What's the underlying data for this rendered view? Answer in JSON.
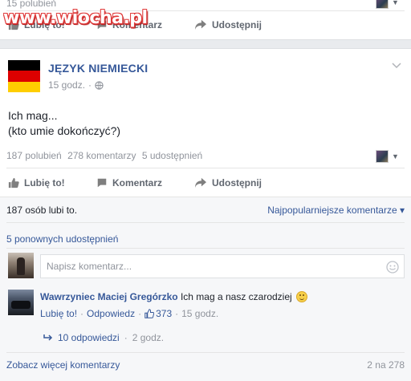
{
  "watermark": "www.wiocha.pl",
  "top_post": {
    "likes_text": "15 polubień",
    "actions": {
      "like": "Lubię to!",
      "comment": "Komentarz",
      "share": "Udostępnij"
    }
  },
  "post": {
    "author": "JĘZYK NIEMIECKI",
    "time": "15 godz.",
    "dot": "·",
    "text_line1": "Ich mag...",
    "text_line2": "(kto umie dokończyć?)",
    "stats": {
      "likes": "187 polubień",
      "comments": "278 komentarzy",
      "shares": "5 udostępnień"
    },
    "actions": {
      "like": "Lubię to!",
      "comment": "Komentarz",
      "share": "Udostępnij"
    },
    "likes_line": "187 osób lubi to.",
    "sort_label": "Najpopularniejsze komentarze",
    "sort_caret": "▾",
    "reshares": "5 ponownych udostępnień",
    "comment_placeholder": "Napisz komentarz...",
    "comment": {
      "author": "Wawrzyniec Maciej Gregórzko",
      "text": "Ich mag a nasz czarodziej",
      "like": "Lubię to!",
      "reply": "Odpowiedz",
      "dot": "·",
      "likes": "373",
      "time": "15 godz.",
      "replies": "10 odpowiedzi",
      "replies_time": "2 godz."
    },
    "more_comments": "Zobacz więcej komentarzy",
    "count": "2 na 278"
  },
  "colors": {
    "link": "#365899",
    "muted": "#90949c",
    "flag_black": "#000000",
    "flag_red": "#dd0000",
    "flag_gold": "#ffce00"
  },
  "icons": [
    "thumbs-up-icon",
    "comment-icon",
    "share-arrow-icon",
    "globe-icon",
    "chevron-down-icon",
    "smiley-icon",
    "reply-arrow-icon"
  ]
}
